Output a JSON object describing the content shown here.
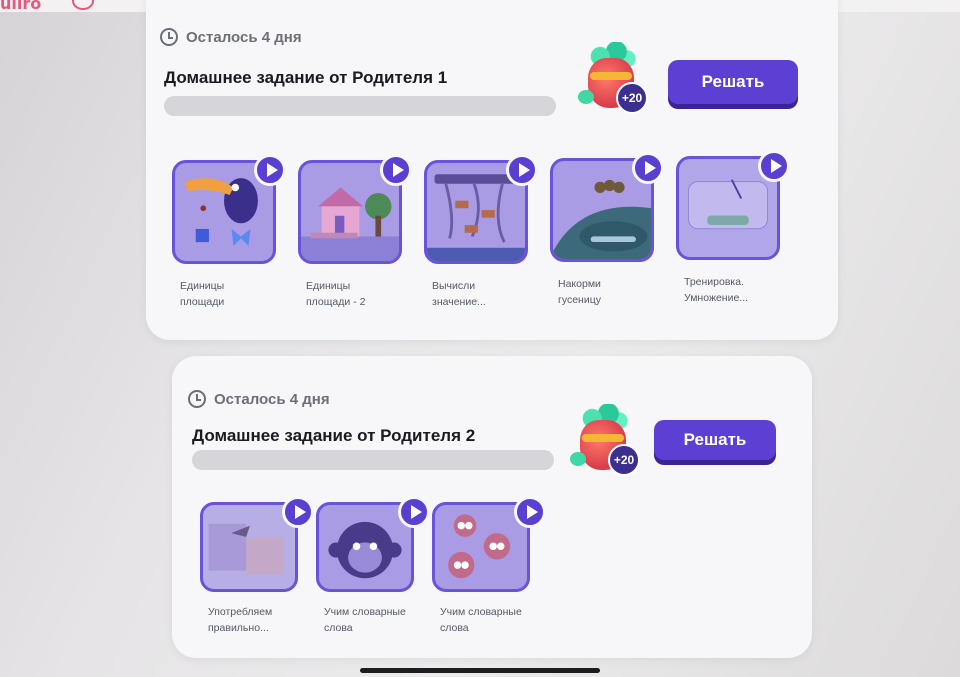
{
  "colors": {
    "accent": "#5d3fd3",
    "thumb_border": "#6a53d8",
    "progress": "#d6d5da"
  },
  "homeworks": [
    {
      "remaining": "Осталось 4 дня",
      "title": "Домашнее задание от Родителя 1",
      "reward": "+20",
      "button": "Решать",
      "progress": 0,
      "tasks": [
        {
          "label_1": "Единицы",
          "label_2": "площади"
        },
        {
          "label_1": "Единицы",
          "label_2": "площади - 2"
        },
        {
          "label_1": "Вычисли",
          "label_2": "значение..."
        },
        {
          "label_1": "Накорми",
          "label_2": "гусеницу"
        },
        {
          "label_1": "Тренировка.",
          "label_2": "Умножение..."
        }
      ]
    },
    {
      "remaining": "Осталось 4 дня",
      "title": "Домашнее задание от Родителя 2",
      "reward": "+20",
      "button": "Решать",
      "progress": 0,
      "tasks": [
        {
          "label_1": "Употребляем",
          "label_2": "правильно..."
        },
        {
          "label_1": "Учим словарные",
          "label_2": "слова"
        },
        {
          "label_1": "Учим словарные",
          "label_2": "слова"
        }
      ]
    }
  ]
}
